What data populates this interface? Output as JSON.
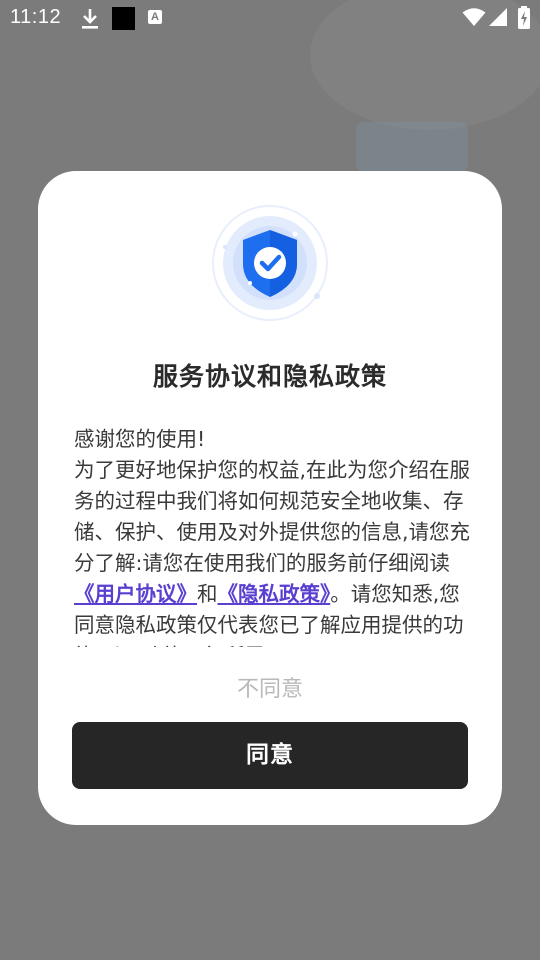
{
  "status_bar": {
    "time": "11:12",
    "icons": [
      "download-icon",
      "black-square-icon",
      "a-icon",
      "wifi-icon",
      "signal-icon",
      "battery-icon"
    ],
    "a_letter": "A"
  },
  "dialog": {
    "icon": "shield-check-icon",
    "title": "服务协议和隐私政策",
    "greeting": "感谢您的使用!",
    "body_before_links": "为了更好地保护您的权益,在此为您介绍在服务的过程中我们将如何规范安全地收集、存储、保护、使用及对外提供您的信息,请您充分了解:请您在使用我们的服务前仔细阅读",
    "user_agreement_link": "《用户协议》",
    "conjunction": "和",
    "privacy_policy_link": "《隐私政策》",
    "body_after_links": "。请您知悉,您同意隐私政策仅代表您已了解应用提供的功能,以及功能运行所需",
    "disagree_label": "不同意",
    "agree_label": "同意"
  },
  "colors": {
    "overlay": "#7b7b7b",
    "dialog_bg": "#ffffff",
    "link": "#5b3fd0",
    "agree_button": "#262626",
    "disagree_text": "#b9b9b9",
    "shield_blue": "#1e6ef0"
  }
}
